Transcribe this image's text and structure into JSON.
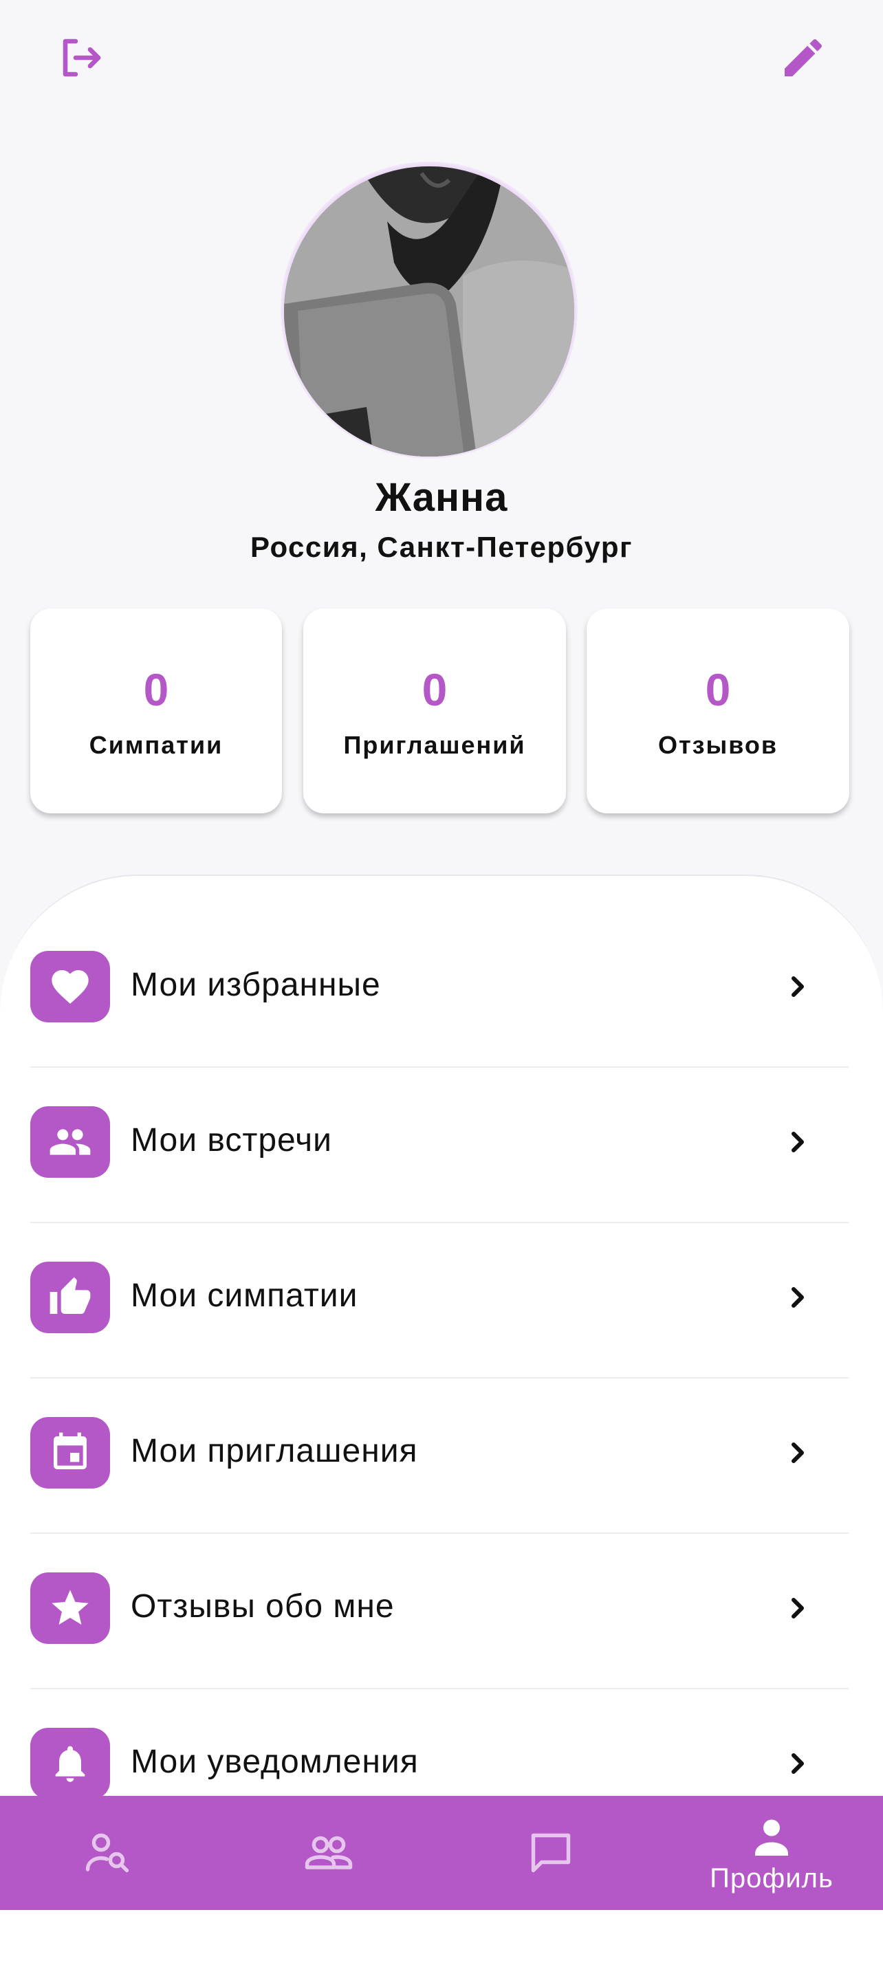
{
  "profile": {
    "name": "Жанна",
    "location": "Россия, Санкт-Петербург"
  },
  "stats": [
    {
      "value": "0",
      "label": "Симпатии"
    },
    {
      "value": "0",
      "label": "Приглашений"
    },
    {
      "value": "0",
      "label": "Отзывов"
    }
  ],
  "menu": [
    {
      "label": "Мои избранные",
      "icon": "heart-icon"
    },
    {
      "label": "Мои встречи",
      "icon": "group-icon"
    },
    {
      "label": "Мои симпатии",
      "icon": "thumbs-up-icon"
    },
    {
      "label": "Мои приглашения",
      "icon": "calendar-icon"
    },
    {
      "label": "Отзывы обо мне",
      "icon": "star-icon"
    },
    {
      "label": "Мои уведомления",
      "icon": "bell-icon"
    }
  ],
  "nav": {
    "items": [
      {
        "icon": "person-search-icon",
        "label": ""
      },
      {
        "icon": "people-icon",
        "label": ""
      },
      {
        "icon": "chat-icon",
        "label": ""
      },
      {
        "icon": "person-icon",
        "label": "Профиль"
      }
    ]
  },
  "colors": {
    "accent": "#b457c7",
    "background": "#f7f6f9"
  }
}
